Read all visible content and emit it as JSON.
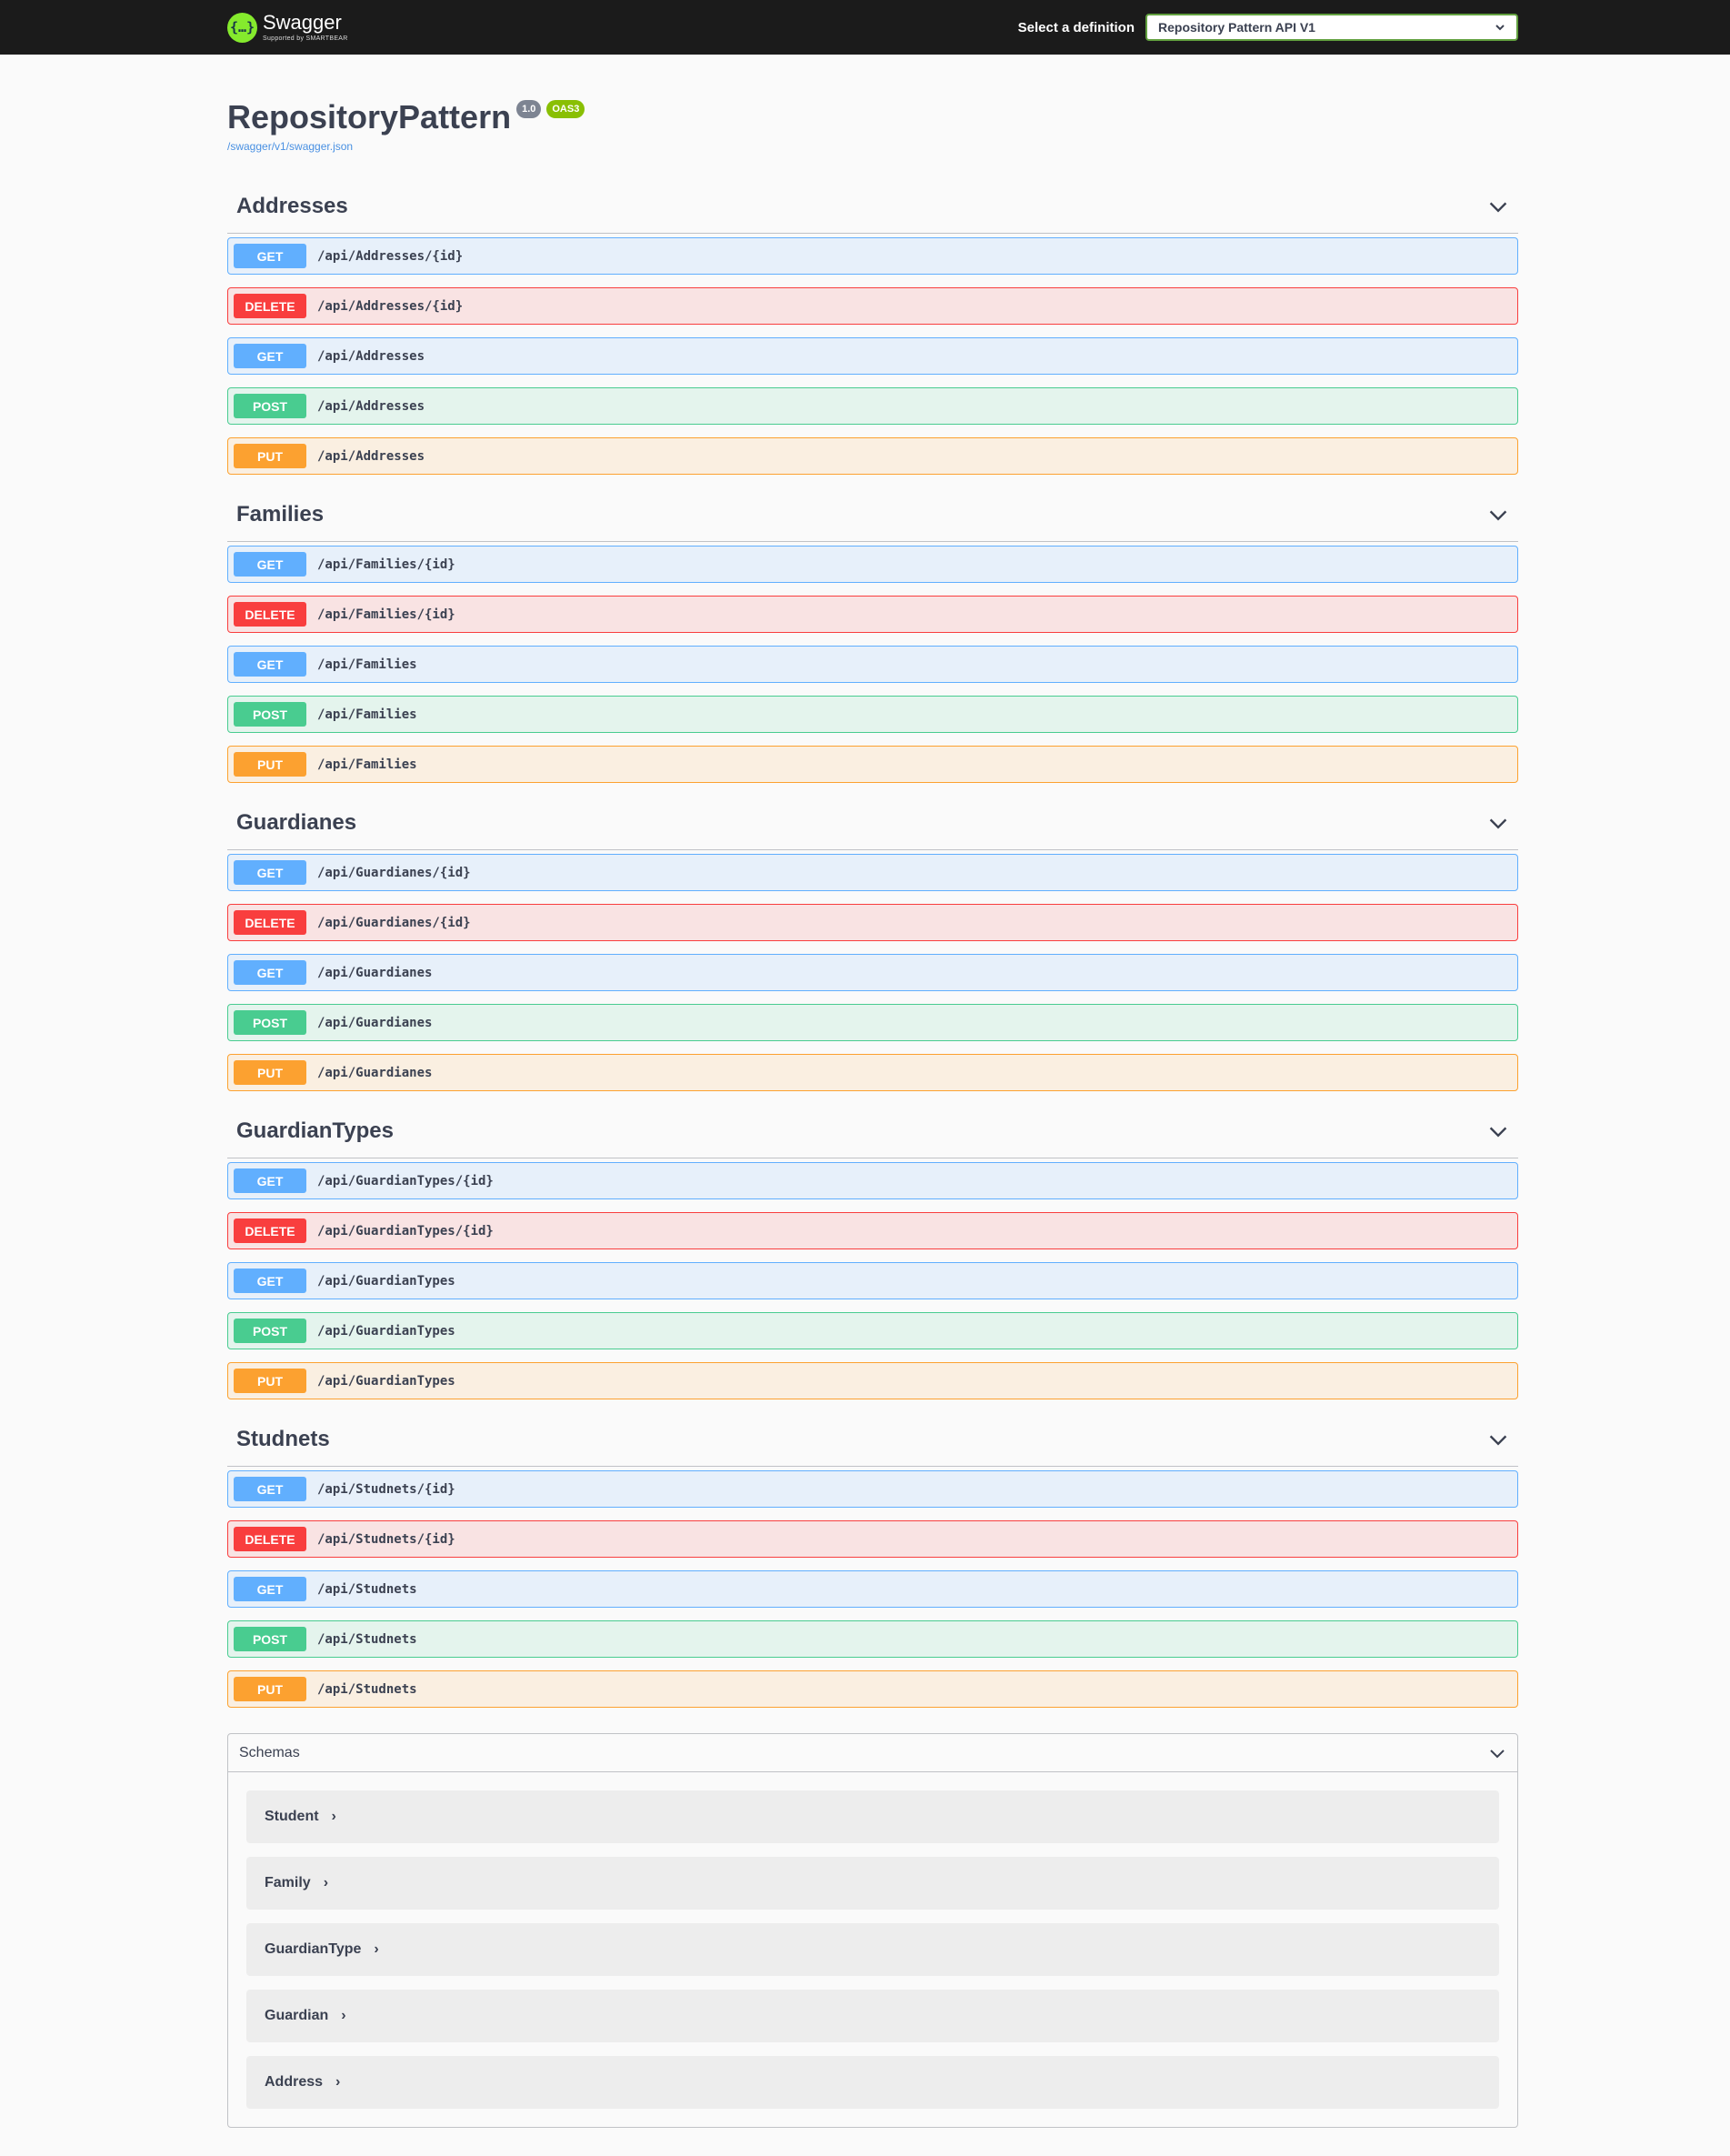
{
  "topbar": {
    "brand_name": "Swagger",
    "brand_sub": "Supported by SMARTBEAR",
    "definition_label": "Select a definition",
    "definition_value": "Repository Pattern API V1"
  },
  "info": {
    "title": "RepositoryPattern",
    "version_badge": "1.0",
    "oas_badge": "OAS3",
    "spec_url": "/swagger/v1/swagger.json"
  },
  "tags": [
    {
      "name": "Addresses",
      "ops": [
        {
          "method": "GET",
          "path": "/api/Addresses/{id}"
        },
        {
          "method": "DELETE",
          "path": "/api/Addresses/{id}"
        },
        {
          "method": "GET",
          "path": "/api/Addresses"
        },
        {
          "method": "POST",
          "path": "/api/Addresses"
        },
        {
          "method": "PUT",
          "path": "/api/Addresses"
        }
      ]
    },
    {
      "name": "Families",
      "ops": [
        {
          "method": "GET",
          "path": "/api/Families/{id}"
        },
        {
          "method": "DELETE",
          "path": "/api/Families/{id}"
        },
        {
          "method": "GET",
          "path": "/api/Families"
        },
        {
          "method": "POST",
          "path": "/api/Families"
        },
        {
          "method": "PUT",
          "path": "/api/Families"
        }
      ]
    },
    {
      "name": "Guardianes",
      "ops": [
        {
          "method": "GET",
          "path": "/api/Guardianes/{id}"
        },
        {
          "method": "DELETE",
          "path": "/api/Guardianes/{id}"
        },
        {
          "method": "GET",
          "path": "/api/Guardianes"
        },
        {
          "method": "POST",
          "path": "/api/Guardianes"
        },
        {
          "method": "PUT",
          "path": "/api/Guardianes"
        }
      ]
    },
    {
      "name": "GuardianTypes",
      "ops": [
        {
          "method": "GET",
          "path": "/api/GuardianTypes/{id}"
        },
        {
          "method": "DELETE",
          "path": "/api/GuardianTypes/{id}"
        },
        {
          "method": "GET",
          "path": "/api/GuardianTypes"
        },
        {
          "method": "POST",
          "path": "/api/GuardianTypes"
        },
        {
          "method": "PUT",
          "path": "/api/GuardianTypes"
        }
      ]
    },
    {
      "name": "Studnets",
      "ops": [
        {
          "method": "GET",
          "path": "/api/Studnets/{id}"
        },
        {
          "method": "DELETE",
          "path": "/api/Studnets/{id}"
        },
        {
          "method": "GET",
          "path": "/api/Studnets"
        },
        {
          "method": "POST",
          "path": "/api/Studnets"
        },
        {
          "method": "PUT",
          "path": "/api/Studnets"
        }
      ]
    }
  ],
  "schemas": {
    "title": "Schemas",
    "items": [
      "Student",
      "Family",
      "GuardianType",
      "Guardian",
      "Address"
    ]
  },
  "colors": {
    "get": "#61affe",
    "delete": "#f93e3e",
    "post": "#49cc90",
    "put": "#fca130",
    "topbar": "#1b1b1b",
    "brand": "#85ea2d"
  }
}
